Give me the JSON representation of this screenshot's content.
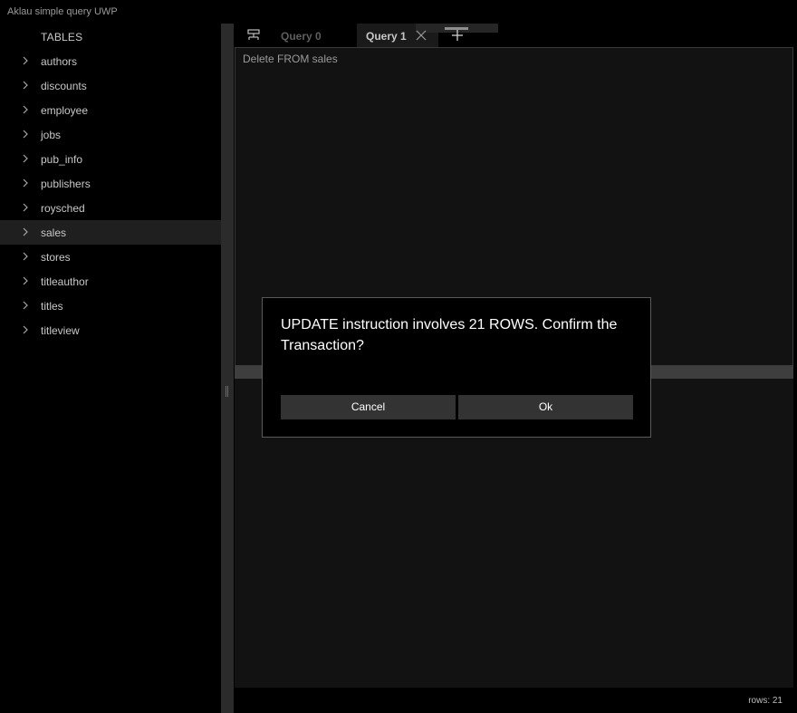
{
  "window": {
    "title": "Aklau simple query UWP"
  },
  "sidebar": {
    "header": "TABLES",
    "tables": [
      {
        "label": "authors"
      },
      {
        "label": "discounts"
      },
      {
        "label": "employee"
      },
      {
        "label": "jobs"
      },
      {
        "label": "pub_info"
      },
      {
        "label": "publishers"
      },
      {
        "label": "roysched"
      },
      {
        "label": "sales",
        "selected": true
      },
      {
        "label": "stores"
      },
      {
        "label": "titleauthor"
      },
      {
        "label": "titles"
      },
      {
        "label": "titleview"
      }
    ]
  },
  "tabs": [
    {
      "label": "Query 0"
    },
    {
      "label": "Query 1",
      "active": true
    }
  ],
  "editor": {
    "text": "Delete FROM sales"
  },
  "status": {
    "rows": "rows: 21"
  },
  "dialog": {
    "message": "UPDATE instruction involves  21 ROWS.  Confirm the Transaction?",
    "cancel_label": "Cancel",
    "ok_label": "Ok"
  },
  "icons": {
    "chevron": "chevron-right-icon",
    "tab_strip": "database-query-icon",
    "close": "close-icon",
    "add": "plus-icon"
  }
}
